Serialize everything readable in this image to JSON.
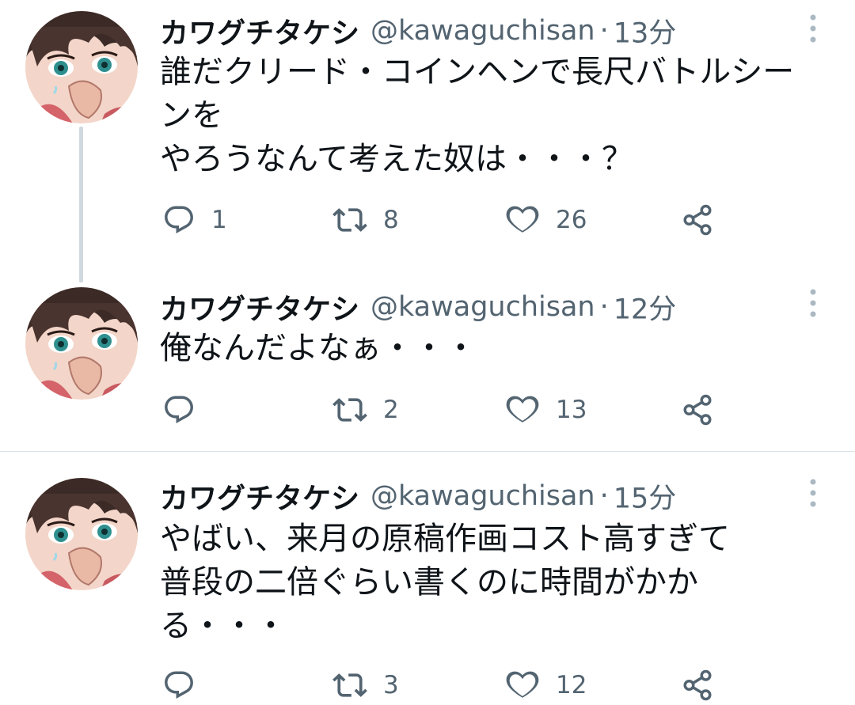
{
  "tweets": [
    {
      "name": "カワグチタケシ",
      "handle": "@kawaguchisan",
      "separator": "·",
      "time": "13分",
      "text": "誰だクリード・コインヘンで長尺バトルシー\nンを\nやろうなんて考えた奴は・・・？",
      "replies": "1",
      "retweets": "8",
      "likes": "26"
    },
    {
      "name": "カワグチタケシ",
      "handle": "@kawaguchisan",
      "separator": "·",
      "time": "12分",
      "text": "俺なんだよなぁ・・・",
      "replies": "",
      "retweets": "2",
      "likes": "13"
    },
    {
      "name": "カワグチタケシ",
      "handle": "@kawaguchisan",
      "separator": "·",
      "time": "15分",
      "text": "やばい、来月の原稿作画コスト高すぎて\n普段の二倍ぐらい書くのに時間がかか\nる・・・",
      "replies": "",
      "retweets": "3",
      "likes": "12"
    }
  ],
  "colors": {
    "text_primary": "#0f1419",
    "text_secondary": "#536471",
    "thread_line": "#cfd9de",
    "divider": "#dbe2e6",
    "icon": "#536471"
  },
  "icons": {
    "reply": "reply-icon",
    "retweet": "retweet-icon",
    "like": "heart-icon",
    "share": "share-icon",
    "more": "more-vertical-icon"
  }
}
